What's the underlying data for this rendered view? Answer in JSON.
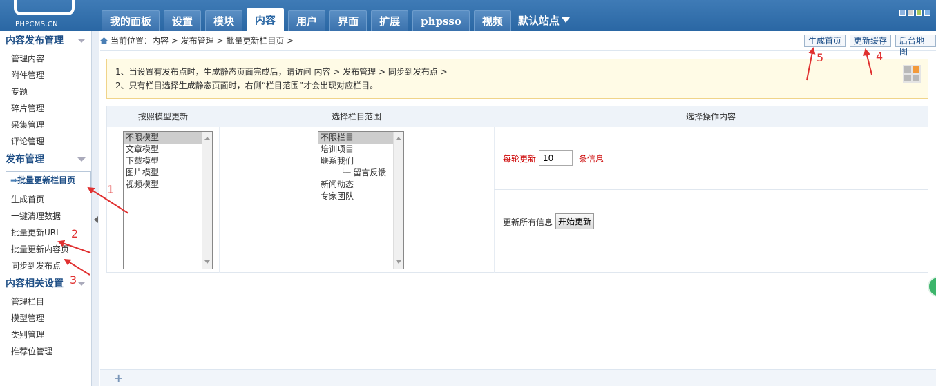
{
  "logo": {
    "text": "PHPCMS.CN"
  },
  "nav": {
    "tabs": [
      "我的面板",
      "设置",
      "模块",
      "内容",
      "用户",
      "界面",
      "扩展",
      "phpsso",
      "视频"
    ],
    "active": "内容",
    "site_select": "默认站点"
  },
  "skin_colors": [
    "#8fb4e0",
    "#cfcfcf",
    "#a8c85c",
    "#7fb2e6"
  ],
  "sidebar": {
    "sections": [
      {
        "title": "内容发布管理",
        "items": [
          "管理内容",
          "附件管理",
          "专题",
          "碎片管理",
          "采集管理",
          "评论管理"
        ]
      },
      {
        "title": "发布管理",
        "current": "批量更新栏目页",
        "items": [
          "生成首页",
          "一键清理数据",
          "批量更新URL",
          "批量更新内容页",
          "同步到发布点"
        ]
      },
      {
        "title": "内容相关设置",
        "items": [
          "管理栏目",
          "模型管理",
          "类别管理",
          "推荐位管理"
        ]
      }
    ]
  },
  "breadcrumb": "当前位置：内容 > 发布管理 > 批量更新栏目页 >",
  "top_buttons": {
    "generate_home": "生成首页",
    "update_cache": "更新缓存",
    "backend_map": "后台地图"
  },
  "tips": [
    "1、当设置有发布点时，生成静态页面完成后，请访问 内容 > 发布管理 > 同步到发布点 >",
    "2、只有栏目选择生成静态页面时，右侧“栏目范围”才会出现对应栏目。"
  ],
  "table": {
    "headers": [
      "按照模型更新",
      "选择栏目范围",
      "选择操作内容"
    ],
    "models": [
      "不限模型",
      "文章模型",
      "下载模型",
      "图片模型",
      "视频模型"
    ],
    "models_selected": "不限模型",
    "categories": [
      "不限栏目",
      "培训项目",
      "联系我们",
      "└─ 留言反馈",
      "新闻动态",
      "专家团队"
    ],
    "categories_selected": "不限栏目",
    "rounds_label": "每轮更新",
    "rounds_value": "10",
    "rounds_unit": "条信息",
    "all_label": "更新所有信息",
    "start_button": "开始更新"
  },
  "annotations": [
    "1",
    "2",
    "3",
    "4",
    "5"
  ],
  "annotation_color": "#e03030"
}
